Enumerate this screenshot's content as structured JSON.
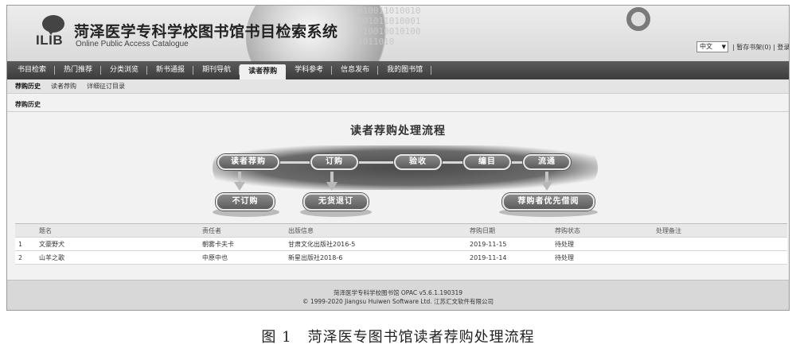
{
  "header": {
    "logo_text": "ILIB",
    "title": "菏泽医学专科学校图书馆书目检索系统",
    "subtitle": "Online Public Access Catalogue",
    "language": "中文",
    "top_links": "| 暂存书架(0) | 登录"
  },
  "nav": {
    "items": [
      {
        "label": "书目检索"
      },
      {
        "label": "热门推荐"
      },
      {
        "label": "分类浏览"
      },
      {
        "label": "新书通报"
      },
      {
        "label": "期刊导航"
      },
      {
        "label": "读者荐购"
      },
      {
        "label": "学科参考"
      },
      {
        "label": "信息发布"
      },
      {
        "label": "我的图书馆"
      }
    ],
    "active_index": 5
  },
  "subnav": {
    "items": [
      {
        "label": "荐购历史"
      },
      {
        "label": "读者荐购"
      },
      {
        "label": "详细征订目录"
      }
    ]
  },
  "breadcrumb": "荐购历史",
  "flow": {
    "title": "读者荐购处理流程",
    "steps": [
      "读者荐购",
      "订购",
      "验收",
      "编目",
      "流通"
    ],
    "results": [
      "不订购",
      "无货退订",
      "荐购者优先借阅"
    ]
  },
  "table": {
    "headers": [
      "",
      "题名",
      "责任者",
      "出版信息",
      "荐购日期",
      "荐购状态",
      "处理备注"
    ],
    "rows": [
      [
        "1",
        "文豪野犬",
        "朝雾卡夫卡",
        "甘肃文化出版社2016-5",
        "2019-11-15",
        "待处理",
        ""
      ],
      [
        "2",
        "山羊之歌",
        "中原中也",
        "新星出版社2018-6",
        "2019-11-14",
        "待处理",
        ""
      ]
    ]
  },
  "footer": {
    "line1": "菏泽医学专科学校图书馆  OPAC v5.6.1.190319",
    "line2": "© 1999-2020 Jiangsu Huiwen Software Ltd. 江苏汇文软件有限公司"
  },
  "caption": {
    "figure": "图 1",
    "text": "菏泽医专图书馆读者荐购处理流程"
  },
  "colors": {
    "nav_bg": "#4a4a4a",
    "pill_bg": "#6e6e6e",
    "footer_bg": "#d8d8d8"
  }
}
